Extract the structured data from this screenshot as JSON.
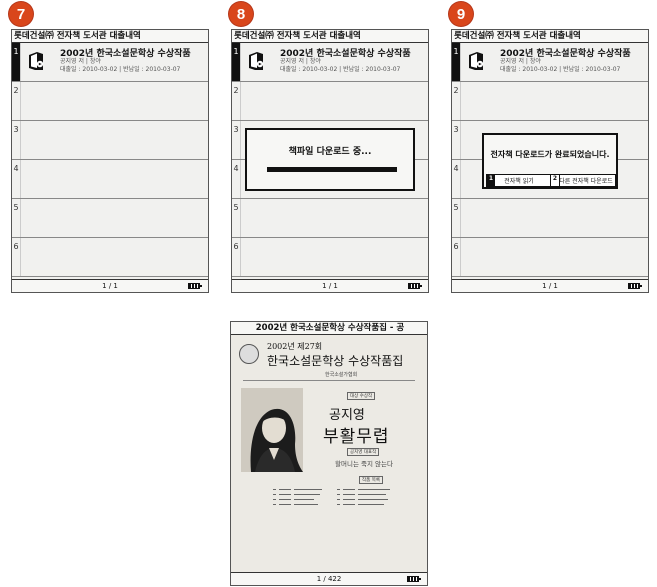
{
  "steps": [
    "7",
    "8",
    "9"
  ],
  "list_screen": {
    "title": "롯데건설㈜ 전자책 도서관 대출내역",
    "book": {
      "title": "2002년 한국소설문학상 수상작품",
      "author_line": "공지영 저 | 창야",
      "dates_line": "대출일 : 2010-03-02 | 반납일 : 2010-03-07"
    },
    "row_numbers": [
      "1",
      "2",
      "3",
      "4",
      "5",
      "6"
    ],
    "page_indicator": "1 / 1"
  },
  "download_dialog": {
    "message": "책파일 다운로드 중...",
    "progress": 1.0
  },
  "complete_dialog": {
    "message": "전자책 다운로드가 완료되었습니다.",
    "btn1_num": "1",
    "btn1_label": "전자책 읽기",
    "btn2_num": "2",
    "btn2_label": "다른 전자책 다운로드"
  },
  "reader": {
    "title": "2002년 한국소설문학상 수상작품집 - 공",
    "cover_year": "2002년 제27회",
    "cover_main": "한국소설문학상 수상작품집",
    "cover_publisher": "한국소설가협회",
    "cover_tag1": "대상 수상작",
    "cover_author": "공지영",
    "cover_work": "부활무렵",
    "cover_tag2": "공지영 대표작",
    "cover_subtitle": "할머니는 죽지 않는다",
    "cover_tag3": "작품 목록",
    "page_indicator": "1 / 422"
  }
}
